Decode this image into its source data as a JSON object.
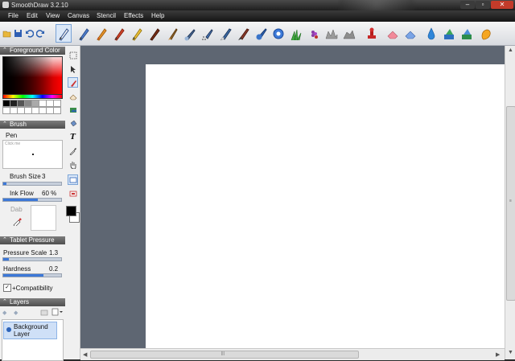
{
  "window": {
    "title": "SmoothDraw 3.2.10",
    "min_label": "–",
    "max_label": "▫",
    "close_label": "✕"
  },
  "menu": [
    "File",
    "Edit",
    "View",
    "Canvas",
    "Stencil",
    "Effects",
    "Help"
  ],
  "toolbar": {
    "file_tools": [
      "open-icon",
      "save-icon",
      "undo-icon",
      "redo-icon"
    ],
    "brush_tools": [
      "pen",
      "pencil",
      "crayon",
      "marker",
      "calligraphy",
      "charcoal",
      "oil-brush",
      "airbrush",
      "spray",
      "smudge",
      "watercolor",
      "blur",
      "grass",
      "flower",
      "tree",
      "rock",
      "stamp",
      "eraser",
      "soft-eraser",
      "water-drop",
      "bucket-fill",
      "paint-bucket",
      "hand"
    ]
  },
  "foreground_color": {
    "header": "Foreground Color",
    "swatches": [
      "#000000",
      "#222222",
      "#555555",
      "#888888",
      "#aaaaaa",
      "#ffffff",
      "#ffffff",
      "#ffffff",
      "#ffffff",
      "#ffffff",
      "#ffffff",
      "#ffffff",
      "#ffffff",
      "#ffffff",
      "#ffffff",
      "#ffffff"
    ]
  },
  "brush": {
    "header": "Brush",
    "name": "Pen",
    "preview_hint": "Click me",
    "size_label": "Brush Size",
    "size_value": "3",
    "size_fraction": 0.05,
    "ink_label": "Ink Flow",
    "ink_value": "60 %",
    "ink_fraction": 0.6,
    "dab_label": "Dab",
    "fg_color": "#000000",
    "bg_color": "#ffffff"
  },
  "tablet": {
    "header": "Tablet Pressure",
    "pressure_label": "Pressure Scale",
    "pressure_value": "1.3",
    "pressure_fraction": 0.1,
    "hardness_label": "Hardness",
    "hardness_value": "0.2",
    "hardness_fraction": 0.7,
    "compat_label": "+Compatibility",
    "compat_checked": true
  },
  "layers": {
    "header": "Layers",
    "items": [
      {
        "name": "Background Layer"
      }
    ]
  },
  "side_tools": [
    "select-rect-icon",
    "move-icon",
    "brush-icon",
    "eraser-icon",
    "stamp-icon",
    "fill-icon",
    "text-icon",
    "eyedropper-icon",
    "hand-icon",
    "rect-icon",
    "rect-fill-icon"
  ],
  "colors": {
    "accent": "#3c78d8",
    "workspace": "#5e6672",
    "canvas": "#ffffff"
  }
}
